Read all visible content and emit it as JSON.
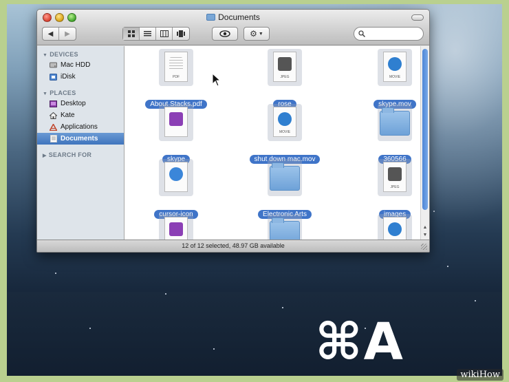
{
  "window": {
    "title": "Documents",
    "search_placeholder": "",
    "status": "12 of 12 selected, 48.97 GB available"
  },
  "toolbar": {
    "back_icon": "back-arrow-icon",
    "forward_icon": "forward-arrow-icon",
    "view_icons": [
      "icon-view-icon",
      "list-view-icon",
      "column-view-icon",
      "coverflow-view-icon"
    ],
    "quicklook_icon": "eye-icon",
    "action_icon": "gear-icon"
  },
  "sidebar": {
    "sections": [
      {
        "label": "DEVICES",
        "items": [
          {
            "label": "Mac HDD",
            "icon": "hard-drive-icon"
          },
          {
            "label": "iDisk",
            "icon": "idisk-icon"
          }
        ]
      },
      {
        "label": "PLACES",
        "items": [
          {
            "label": "Desktop",
            "icon": "desktop-icon"
          },
          {
            "label": "Kate",
            "icon": "home-icon"
          },
          {
            "label": "Applications",
            "icon": "applications-icon"
          },
          {
            "label": "Documents",
            "icon": "documents-icon",
            "selected": true
          }
        ]
      },
      {
        "label": "SEARCH FOR",
        "items": []
      }
    ]
  },
  "files": [
    {
      "label": "About Stacks.pdf",
      "kind": "pdf",
      "tag": "PDF"
    },
    {
      "label": "rose",
      "kind": "jpeg",
      "tag": "JPEG"
    },
    {
      "label": "skype.mov",
      "kind": "movie",
      "tag": "MOVIE"
    },
    {
      "label": "skype",
      "kind": "app",
      "tag": ""
    },
    {
      "label": "shut down mac.mov",
      "kind": "movie",
      "tag": "MOVIE"
    },
    {
      "label": "360566",
      "kind": "folder",
      "tag": ""
    },
    {
      "label": "cursor-icon",
      "kind": "safari",
      "tag": ""
    },
    {
      "label": "Electronic Arts",
      "kind": "folder",
      "tag": ""
    },
    {
      "label": "images",
      "kind": "jpeg",
      "tag": "JPEG"
    },
    {
      "label": "",
      "kind": "app",
      "tag": ""
    },
    {
      "label": "",
      "kind": "folder",
      "tag": ""
    },
    {
      "label": "",
      "kind": "movie",
      "tag": "MPEG-4"
    }
  ],
  "overlay": {
    "shortcut": "⌘A",
    "watermark": "wikiHow"
  }
}
